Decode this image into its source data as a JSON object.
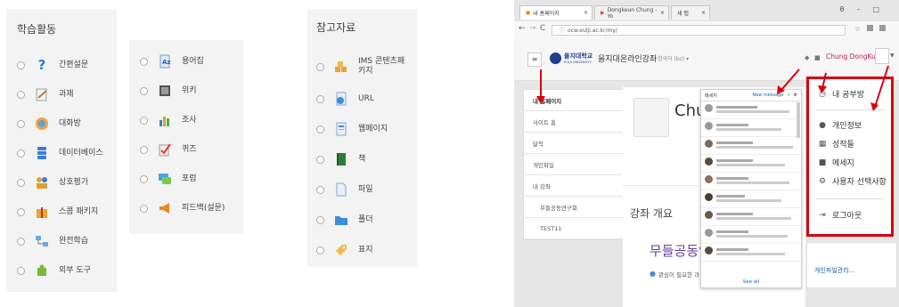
{
  "panel1": {
    "title": "학습활동",
    "items": [
      {
        "label": "간편설문",
        "icon": "question-icon"
      },
      {
        "label": "과제",
        "icon": "assignment-icon"
      },
      {
        "label": "대화방",
        "icon": "chat-icon"
      },
      {
        "label": "데이터베이스",
        "icon": "database-icon"
      },
      {
        "label": "상호평가",
        "icon": "peer-review-icon"
      },
      {
        "label": "스콤 패키지",
        "icon": "scorm-icon"
      },
      {
        "label": "완전학습",
        "icon": "lesson-icon"
      },
      {
        "label": "외부 도구",
        "icon": "puzzle-icon"
      }
    ]
  },
  "panel2": {
    "items": [
      {
        "label": "용어집",
        "icon": "glossary-icon"
      },
      {
        "label": "위키",
        "icon": "wiki-icon"
      },
      {
        "label": "조사",
        "icon": "survey-icon"
      },
      {
        "label": "퀴즈",
        "icon": "quiz-icon"
      },
      {
        "label": "포럼",
        "icon": "forum-icon"
      },
      {
        "label": "피드백(설문)",
        "icon": "megaphone-icon"
      }
    ]
  },
  "panel3": {
    "title": "참고자료",
    "items": [
      {
        "label": "IMS 콘텐츠패키지",
        "icon": "package-icon"
      },
      {
        "label": "URL",
        "icon": "url-icon"
      },
      {
        "label": "웹페이지",
        "icon": "page-icon"
      },
      {
        "label": "책",
        "icon": "book-icon"
      },
      {
        "label": "파일",
        "icon": "file-icon"
      },
      {
        "label": "폴더",
        "icon": "folder-icon"
      },
      {
        "label": "표지",
        "icon": "label-icon"
      }
    ]
  },
  "browser": {
    "tabs": [
      "내 홈페이지",
      "Dongkeun Chung - Yo",
      "새 탭"
    ],
    "url": "ocw.eulji.ac.kr/my/",
    "win_controls": [
      "θ",
      "–",
      "□"
    ]
  },
  "site": {
    "logo_text": "을지대학교",
    "logo_sub": "EULJI UNIVERSITY",
    "course_name": "을지대온라인강좌",
    "lang": "한국어 (ko) ▾",
    "user": "Chung DongKun"
  },
  "left_nav": [
    "내 홈페이지",
    "사이트 홈",
    "달력",
    "개인파일",
    "내 강좌",
    "무들공동연구회",
    "TEST11"
  ],
  "main": {
    "name_partial": "Chu",
    "overview": "강좌 개요",
    "course_title_partial": "무들공동연",
    "note": "관심이 필요한 과",
    "file_link": "개인파일관리..."
  },
  "popup": {
    "header": "메세지",
    "new_message": "New message",
    "see_all": "See all"
  },
  "user_menu": [
    {
      "label": "내 공부방",
      "icon": "dashboard-icon"
    },
    {
      "label": "개인정보",
      "icon": "user-icon"
    },
    {
      "label": "성적들",
      "icon": "grades-icon"
    },
    {
      "label": "메세지",
      "icon": "message-icon"
    },
    {
      "label": "사용자 선택사항",
      "icon": "gear-icon"
    },
    {
      "label": "로그아웃",
      "icon": "logout-icon"
    }
  ],
  "colors": {
    "accent_red": "#d9000d",
    "brand_blue": "#1d3f8f"
  }
}
